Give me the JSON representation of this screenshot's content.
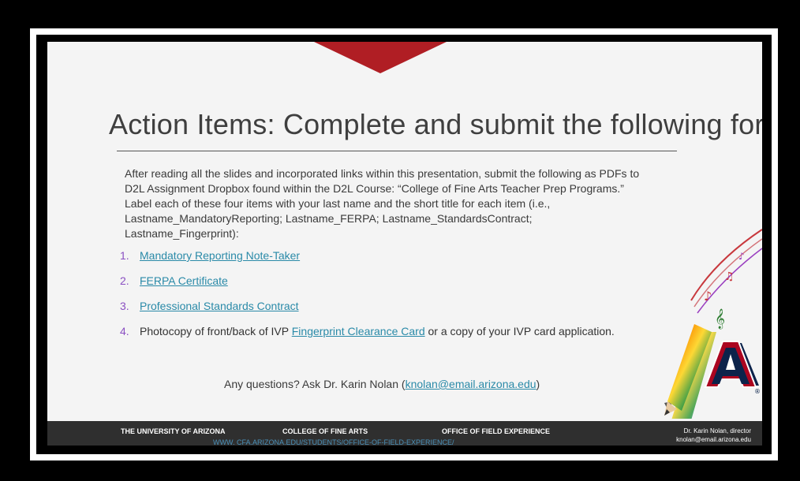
{
  "slide": {
    "title": "Action Items: Complete and submit the following forms:",
    "intro": "After reading all the slides and incorporated links within this presentation, submit the following as PDFs to D2L Assignment Dropbox found within the D2L Course: “College of Fine Arts Teacher Prep Programs.” Label each of these four items with your last name and the short title for each item (i.e., Lastname_MandatoryReporting; Lastname_FERPA; Lastname_StandardsContract; Lastname_Fingerprint):",
    "items": [
      {
        "num": "1.",
        "link": "Mandatory Reporting Note-Taker"
      },
      {
        "num": "2.",
        "link": "FERPA Certificate"
      },
      {
        "num": "3.",
        "link": "Professional Standards Contract"
      },
      {
        "num": "4.",
        "before": "Photocopy of front/back of IVP ",
        "link": "Fingerprint Clearance Card",
        "after": " or a copy of your IVP card application."
      }
    ],
    "question": {
      "before": "Any questions? Ask Dr. Karin Nolan (",
      "email": "knolan@email.arizona.edu",
      "after": ")"
    }
  },
  "footer": {
    "university": "THE UNIVERSITY OF ARIZONA",
    "college": "COLLEGE OF FINE ARTS",
    "office": "OFFICE OF FIELD EXPERIENCE",
    "url": "WWW. CFA.ARIZONA.EDU/STUDENTS/OFFICE-OF-FIELD-EXPERIENCE/",
    "director": "Dr. Karin Nolan, director",
    "email": "knolan@email.arizona.edu"
  },
  "logo": {
    "letter": "A",
    "mark": "®"
  },
  "colors": {
    "accent": "#b01e24",
    "link": "#2a8aa8",
    "number": "#8a4fc2",
    "footer": "#2f2f2f",
    "logo_blue": "#0c234b"
  }
}
